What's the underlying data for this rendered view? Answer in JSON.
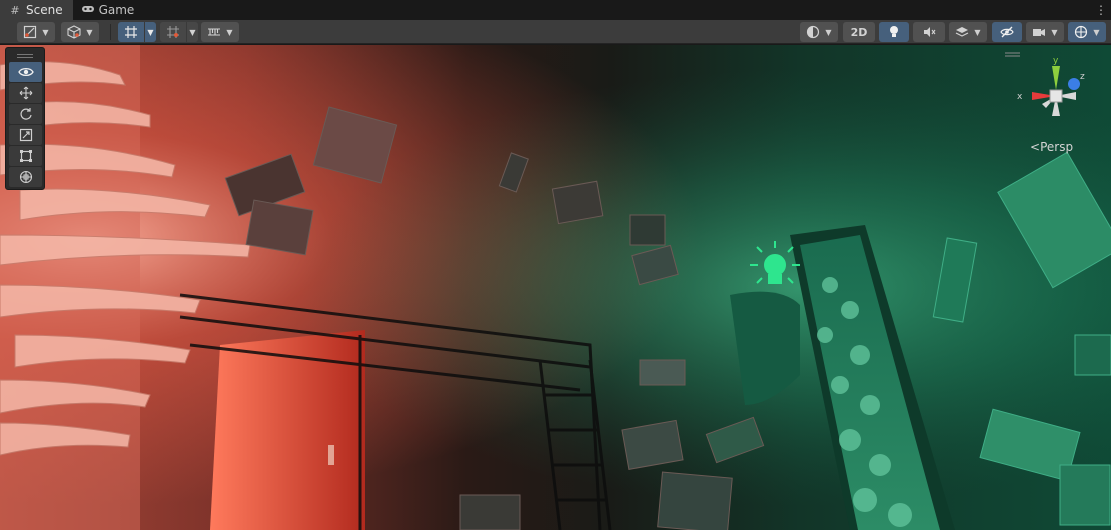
{
  "tabs": [
    {
      "label": "Scene",
      "icon": "grid-icon",
      "active": true
    },
    {
      "label": "Game",
      "icon": "gamepad-icon",
      "active": false
    }
  ],
  "toolbar": {
    "twod_label": "2D",
    "buttons": [
      "draw-mode",
      "transform-pivot",
      "snap-grid",
      "increment-snap",
      "grid-settings",
      "shading-mode",
      "2d-toggle",
      "lighting-toggle",
      "audio-toggle",
      "effects-toggle",
      "visibility-toggle",
      "camera-settings",
      "gizmos-toggle"
    ]
  },
  "tools": [
    {
      "name": "view-tool",
      "icon": "eye-icon",
      "active": true
    },
    {
      "name": "move-tool",
      "icon": "move-arrows-icon",
      "active": false
    },
    {
      "name": "rotate-tool",
      "icon": "rotate-icon",
      "active": false
    },
    {
      "name": "scale-tool",
      "icon": "scale-icon",
      "active": false
    },
    {
      "name": "rect-tool",
      "icon": "rect-icon",
      "active": false
    },
    {
      "name": "transform-tool",
      "icon": "transform-icon",
      "active": false
    }
  ],
  "gizmo": {
    "projection_label": "Persp",
    "axes": [
      {
        "label": "y",
        "color": "#8ecf3e"
      },
      {
        "label": "x",
        "color": "#e53b3b"
      },
      {
        "label": "z",
        "color": "#3b7ee5"
      }
    ]
  },
  "colors": {
    "red_light": "#ff6a5a",
    "green_light": "#2fd48a",
    "selected": "#46607c"
  }
}
